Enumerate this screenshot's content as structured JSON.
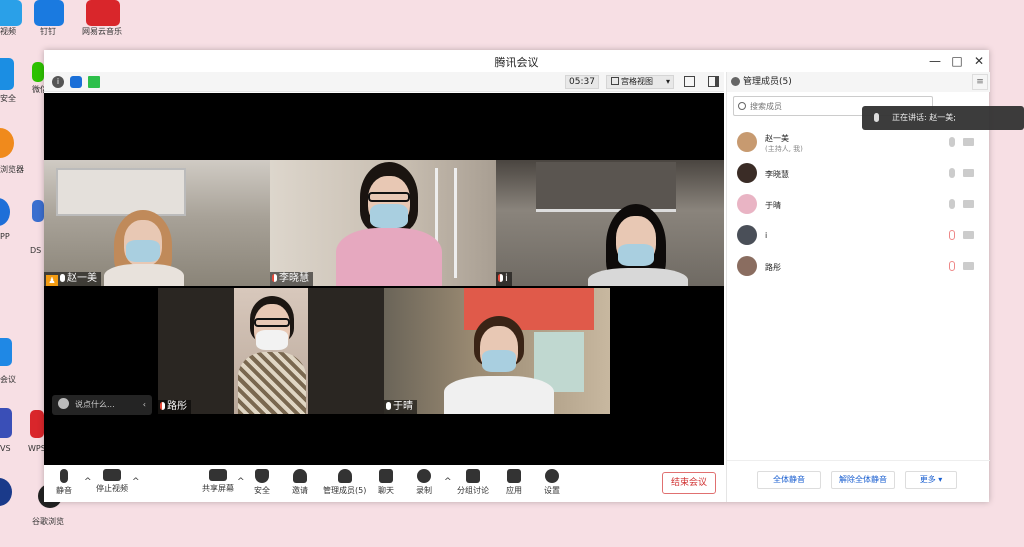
{
  "desktop": {
    "icons": [
      {
        "label": "视频",
        "color": "#2aa0e8"
      },
      {
        "label": "钉钉",
        "color": "#1a7ae0"
      },
      {
        "label": "网易云音乐",
        "color": "#d9262b"
      },
      {
        "label": "安全",
        "color": "#1b8ee3"
      },
      {
        "label": "微信",
        "color": "#2dc100"
      },
      {
        "label": "浏览器",
        "color": "#f08a1c"
      },
      {
        "label": "PP",
        "color": "#1e6fd8"
      },
      {
        "label": "DS",
        "color": "#3b6fcf"
      },
      {
        "label": "会议",
        "color": "#1f88e5"
      },
      {
        "label": "VS",
        "color": "#3a4fb7"
      },
      {
        "label": "WPS",
        "color": "#d9262b"
      },
      {
        "label": "谷歌浏览",
        "color": "#1a3a8a"
      }
    ]
  },
  "window": {
    "title": "腾讯会议",
    "controls": {
      "minimize": "—",
      "maximize": "□",
      "close": "✕"
    }
  },
  "toolbar": {
    "info_icon": "info-icon",
    "shield_icon": "shield-icon",
    "signal_icon": "signal-icon",
    "timer": "05:37",
    "view_mode": "宫格视图",
    "view_caret": "▾"
  },
  "tiles": [
    {
      "name": "赵一美",
      "host": true,
      "bg": "#8a8478",
      "hair": "#c08a5a",
      "top_color": "#cfc9c2"
    },
    {
      "name": "李晓慧",
      "host": false,
      "bg": "#c7bdb0",
      "hair": "#1a1410",
      "top_color": "#e6a8bf"
    },
    {
      "name": "i",
      "host": false,
      "bg": "#6f6a63",
      "hair": "#0e0b0a",
      "top_color": "#d8d8d8"
    },
    {
      "name": "路彤",
      "host": false,
      "bg": "#b9a89a",
      "hair": "#1c1612",
      "top_color": "#7a6850"
    },
    {
      "name": "于晴",
      "host": false,
      "bg": "#9a8a72",
      "hair": "#3a2416",
      "top_color": "#f0f0f0"
    }
  ],
  "chat": {
    "placeholder": "说点什么...",
    "arrow": "‹"
  },
  "bottom_bar": {
    "mute": "静音",
    "stop_video": "停止视频",
    "share_screen": "共享屏幕",
    "security": "安全",
    "invite": "邀请",
    "manage_members": "管理成员(5)",
    "chat": "聊天",
    "record": "录制",
    "breakout": "分组讨论",
    "apps": "应用",
    "settings": "设置",
    "end_meeting": "结束会议",
    "caret": "^"
  },
  "panel": {
    "title": "管理成员(5)",
    "menu": "≡",
    "search_placeholder": "搜索成员",
    "members": [
      {
        "name": "赵一美",
        "sub": "(主持人, 我)",
        "mic_on": true,
        "avatar": "#c79a70"
      },
      {
        "name": "李晓慧",
        "sub": "",
        "mic_on": true,
        "avatar": "#3a2c26"
      },
      {
        "name": "于晴",
        "sub": "",
        "mic_on": true,
        "avatar": "#e9b4c4"
      },
      {
        "name": "i",
        "sub": "",
        "mic_on": false,
        "avatar": "#4a4f58"
      },
      {
        "name": "路彤",
        "sub": "",
        "mic_on": false,
        "avatar": "#8a6d60"
      }
    ],
    "mute_all": "全体静音",
    "unmute_all": "解除全体静音",
    "more": "更多 ▾"
  },
  "tooltip": {
    "speaking": "正在讲话: 赵一美;"
  }
}
